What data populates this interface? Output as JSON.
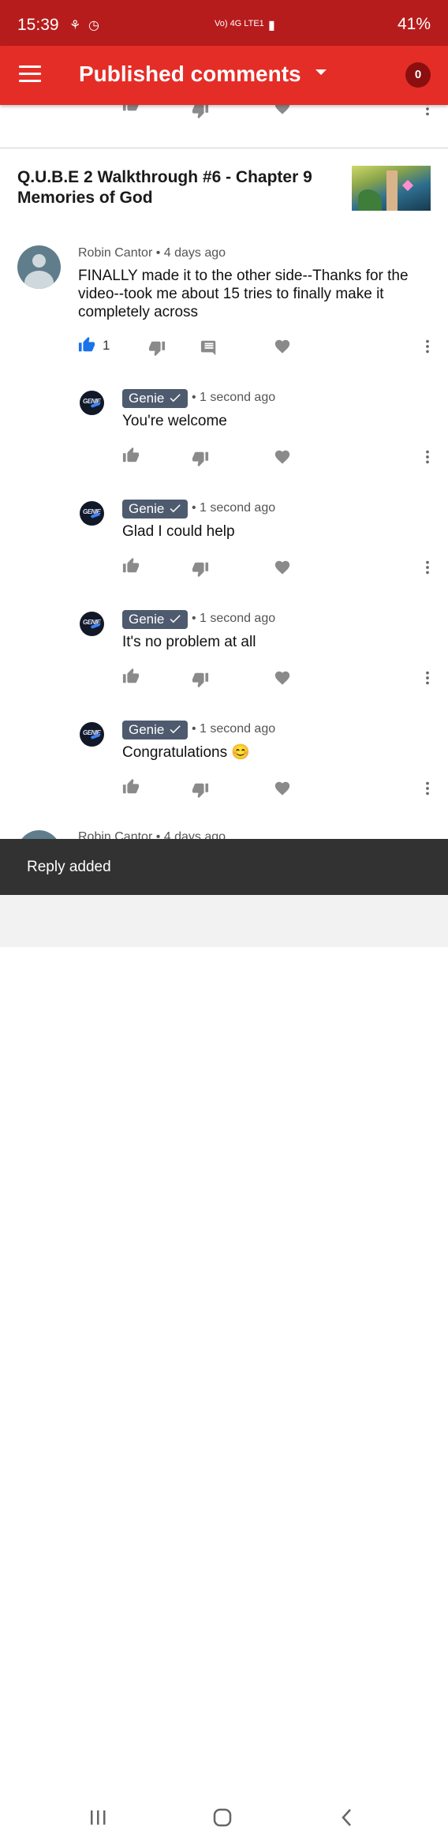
{
  "status_bar": {
    "time": "15:39",
    "network": "Vo) 4G LTE1",
    "battery": "41%"
  },
  "app_bar": {
    "title": "Published comments",
    "count": "0"
  },
  "video": {
    "title": "Q.U.B.E 2 Walkthrough #6 - Chapter 9 Memories of God"
  },
  "comment": {
    "author": "Robin Cantor",
    "time": "4 days ago",
    "text": "FINALLY made it to the other side--Thanks for the video--took me about 15 tries to finally make it completely across",
    "likes": "1"
  },
  "replies": [
    {
      "author": "Genie",
      "time": "1 second ago",
      "text": "You're welcome"
    },
    {
      "author": "Genie",
      "time": "1 second ago",
      "text": "Glad I could help"
    },
    {
      "author": "Genie",
      "time": "1 second ago",
      "text": "It's no problem at all"
    },
    {
      "author": "Genie",
      "time": "1 second ago",
      "text": "Congratulations 😊"
    }
  ],
  "next_comment": {
    "author": "Robin Cantor",
    "time": "4 days ago"
  },
  "snackbar": {
    "text": "Reply added"
  },
  "colors": {
    "accent": "#e52d27",
    "status_bar": "#b71c1c",
    "liked": "#1a73e8",
    "badge": "#4e5b6e"
  }
}
